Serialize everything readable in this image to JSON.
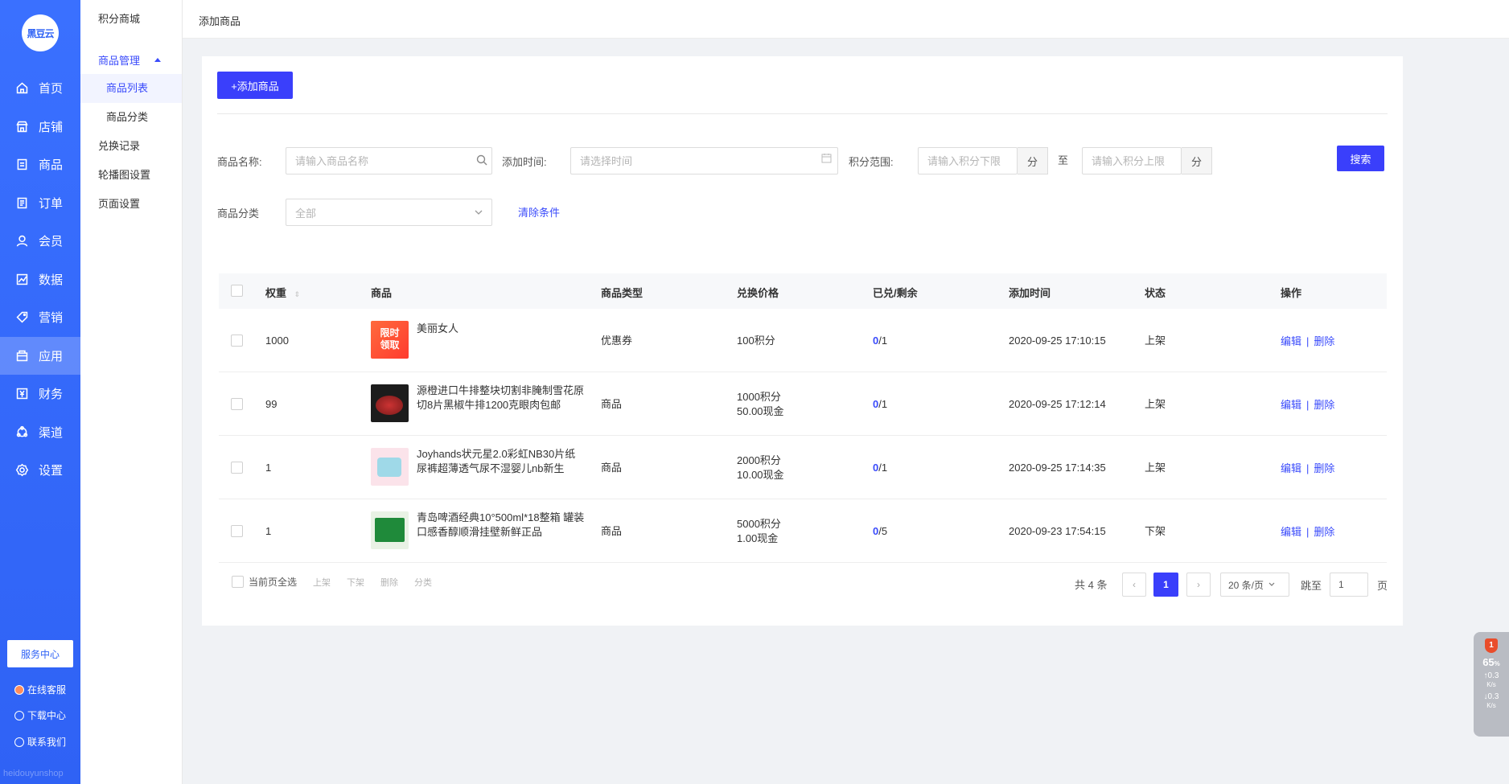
{
  "brand": {
    "logo_text": "黑豆云",
    "watermark": "heidouyunshop"
  },
  "nav": [
    {
      "label": "首页",
      "icon": "home-icon"
    },
    {
      "label": "店铺",
      "icon": "store-icon"
    },
    {
      "label": "商品",
      "icon": "goods-icon"
    },
    {
      "label": "订单",
      "icon": "order-icon"
    },
    {
      "label": "会员",
      "icon": "member-icon"
    },
    {
      "label": "数据",
      "icon": "data-icon"
    },
    {
      "label": "营销",
      "icon": "tag-icon"
    },
    {
      "label": "应用",
      "icon": "app-icon",
      "active": true
    },
    {
      "label": "财务",
      "icon": "finance-icon"
    },
    {
      "label": "渠道",
      "icon": "channel-icon"
    },
    {
      "label": "设置",
      "icon": "gear-icon"
    }
  ],
  "service": {
    "button": "服务中心",
    "online": "在线客服",
    "download": "下载中心",
    "contact": "联系我们"
  },
  "subnav": {
    "title": "积分商城",
    "group": "商品管理",
    "items": [
      "商品列表",
      "商品分类"
    ],
    "other": [
      "兑换记录",
      "轮播图设置",
      "页面设置"
    ]
  },
  "breadcrumb": "添加商品",
  "toolbar": {
    "add_label": "+添加商品"
  },
  "filters": {
    "name_label": "商品名称:",
    "name_placeholder": "请输入商品名称",
    "time_label": "添加时间:",
    "time_placeholder": "请选择时间",
    "range_label": "积分范围:",
    "min_placeholder": "请输入积分下限",
    "max_placeholder": "请输入积分上限",
    "unit": "分",
    "to": "至",
    "search": "搜索",
    "category_label": "商品分类",
    "category_value": "全部",
    "clear": "清除条件"
  },
  "table": {
    "headers": [
      "权重",
      "商品",
      "商品类型",
      "兑换价格",
      "已兑/剩余",
      "添加时间",
      "状态",
      "操作"
    ],
    "rows": [
      {
        "weight": "1000",
        "name": "美丽女人",
        "type": "优惠券",
        "price1": "100积分",
        "price2": "",
        "redeemed": "0",
        "remain": "/1",
        "time": "2020-09-25 17:10:15",
        "status": "上架",
        "thumb_text": "限时领取"
      },
      {
        "weight": "99",
        "name": "源橙进口牛排整块切割非腌制雪花原切8片黑椒牛排1200克眼肉包邮",
        "type": "商品",
        "price1": "1000积分",
        "price2": "50.00现金",
        "redeemed": "0",
        "remain": "/1",
        "time": "2020-09-25 17:12:14",
        "status": "上架",
        "thumb_text": ""
      },
      {
        "weight": "1",
        "name": "Joyhands状元星2.0彩虹NB30片纸尿裤超薄透气尿不湿婴儿nb新生",
        "type": "商品",
        "price1": "2000积分",
        "price2": "10.00现金",
        "redeemed": "0",
        "remain": "/1",
        "time": "2020-09-25 17:14:35",
        "status": "上架",
        "thumb_text": ""
      },
      {
        "weight": "1",
        "name": "青岛啤酒经典10°500ml*18整箱 罐装口感香醇顺滑挂壁新鲜正品",
        "type": "商品",
        "price1": "5000积分",
        "price2": "1.00现金",
        "redeemed": "0",
        "remain": "/5",
        "time": "2020-09-23 17:54:15",
        "status": "下架",
        "thumb_text": ""
      }
    ],
    "edit": "编辑",
    "delete": "删除",
    "sep": "|"
  },
  "footer": {
    "select_all": "当前页全选",
    "actions": [
      "上架",
      "下架",
      "删除",
      "分类"
    ],
    "total": "共 4 条",
    "page": "1",
    "page_size": "20 条/页",
    "goto": "跳至",
    "goto_value": "1",
    "page_unit": "页"
  },
  "widget": {
    "badge": "1",
    "percent": "65",
    "percent_unit": "%",
    "up": "0.3",
    "down": "0.3",
    "speed_unit": "K/s"
  },
  "colors": {
    "sidebar": "#2f62f5",
    "primary": "#3a3ffb",
    "link": "#3a4bfb"
  }
}
